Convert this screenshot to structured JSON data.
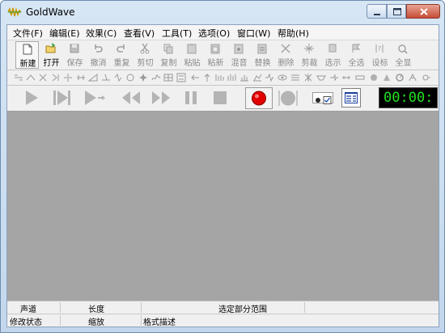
{
  "window": {
    "title": "GoldWave"
  },
  "menu": [
    "文件(F)",
    "编辑(E)",
    "效果(C)",
    "查看(V)",
    "工具(T)",
    "选项(O)",
    "窗口(W)",
    "帮助(H)"
  ],
  "toolbar": [
    {
      "label": "新建",
      "icon": "new-file-icon",
      "enabled": true
    },
    {
      "label": "打开",
      "icon": "open-folder-icon",
      "enabled": true
    },
    {
      "label": "保存",
      "icon": "save-icon",
      "enabled": false
    },
    {
      "label": "撤消",
      "icon": "undo-icon",
      "enabled": false
    },
    {
      "label": "重复",
      "icon": "redo-icon",
      "enabled": false
    },
    {
      "label": "剪切",
      "icon": "cut-icon",
      "enabled": false
    },
    {
      "label": "复制",
      "icon": "copy-icon",
      "enabled": false
    },
    {
      "label": "粘贴",
      "icon": "paste-icon",
      "enabled": false
    },
    {
      "label": "粘新",
      "icon": "paste-new-icon",
      "enabled": false
    },
    {
      "label": "混音",
      "icon": "mix-icon",
      "enabled": false
    },
    {
      "label": "替换",
      "icon": "replace-icon",
      "enabled": false
    },
    {
      "label": "删除",
      "icon": "delete-icon",
      "enabled": false
    },
    {
      "label": "剪裁",
      "icon": "trim-icon",
      "enabled": false
    },
    {
      "label": "选示",
      "icon": "select-view-icon",
      "enabled": false
    },
    {
      "label": "全选",
      "icon": "select-all-icon",
      "enabled": false
    },
    {
      "label": "设标",
      "icon": "set-marker-icon",
      "enabled": false
    },
    {
      "label": "全显",
      "icon": "show-all-icon",
      "enabled": false
    }
  ],
  "transport": {
    "time": "00:00:"
  },
  "status": {
    "row1": [
      "声道",
      "长度",
      "选定部分范围"
    ],
    "row2": [
      "修改状态",
      "缩放",
      "格式描述"
    ]
  },
  "colors": {
    "record": "#e00000",
    "time_text": "#21e021",
    "workspace": "#a5a5a5"
  }
}
